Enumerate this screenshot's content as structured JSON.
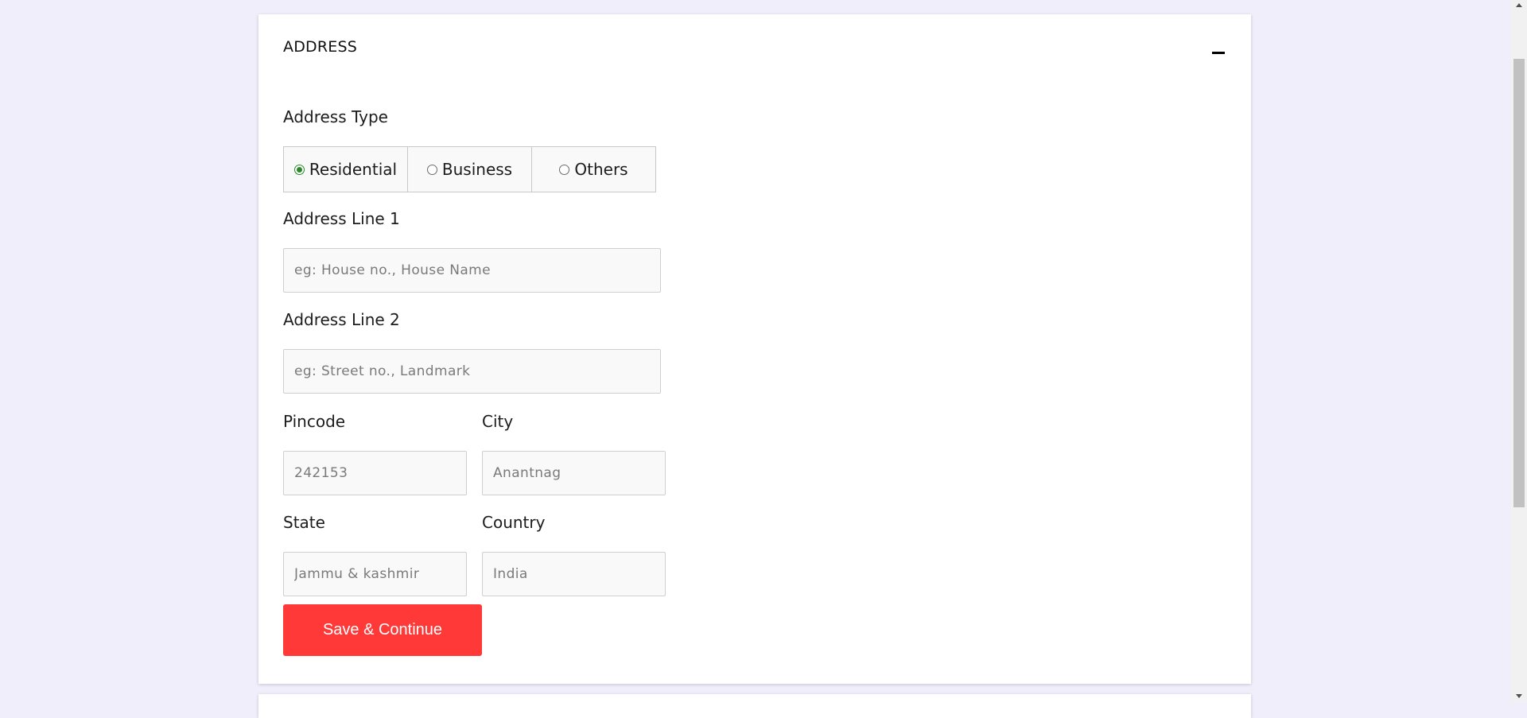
{
  "section": {
    "title": "ADDRESS",
    "collapse_icon": "minus-icon"
  },
  "address_type": {
    "label": "Address Type",
    "options": [
      "Residential",
      "Business",
      "Others"
    ],
    "selected": "Residential"
  },
  "address_line_1": {
    "label": "Address Line 1",
    "placeholder": "eg: House no., House Name"
  },
  "address_line_2": {
    "label": "Address Line 2",
    "placeholder": "eg: Street no., Landmark"
  },
  "pincode": {
    "label": "Pincode",
    "placeholder": "242153"
  },
  "city": {
    "label": "City",
    "placeholder": "Anantnag"
  },
  "state": {
    "label": "State",
    "placeholder": "Jammu & kashmir"
  },
  "country": {
    "label": "Country",
    "placeholder": "India"
  },
  "actions": {
    "save_label": "Save & Continue"
  },
  "colors": {
    "page_background": "#f1eefc",
    "primary_button": "#ff3838",
    "radio_checked": "#2a8a2a"
  }
}
